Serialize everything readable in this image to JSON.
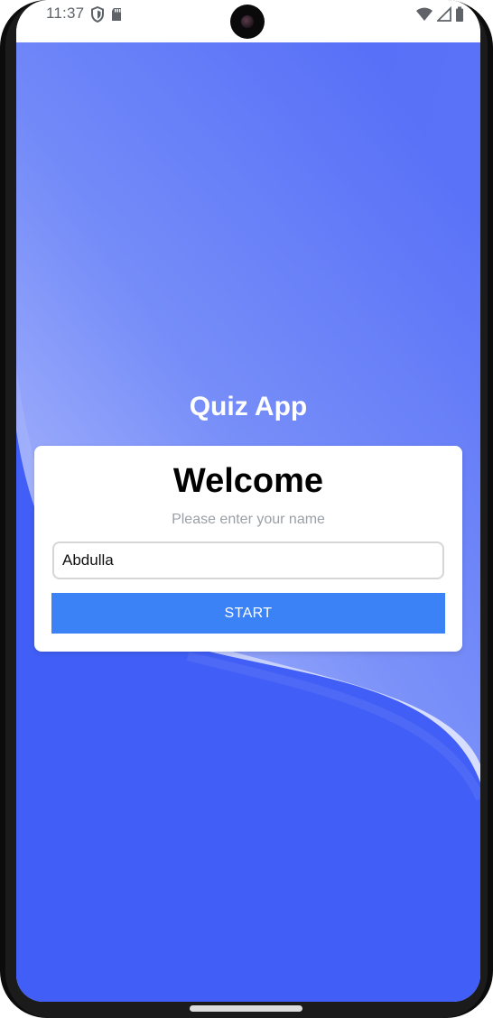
{
  "status_bar": {
    "time": "11:37",
    "icons_left": [
      "shield-icon",
      "sd-card-icon"
    ],
    "icons_right": [
      "wifi-icon",
      "signal-icon",
      "battery-icon"
    ]
  },
  "app": {
    "title": "Quiz App",
    "background_color": "#415ff7",
    "card": {
      "heading": "Welcome",
      "prompt": "Please enter your name",
      "name_input": {
        "value": "Abdulla",
        "placeholder": ""
      },
      "start_button": {
        "label": "START",
        "color": "#3b82f6"
      }
    }
  }
}
